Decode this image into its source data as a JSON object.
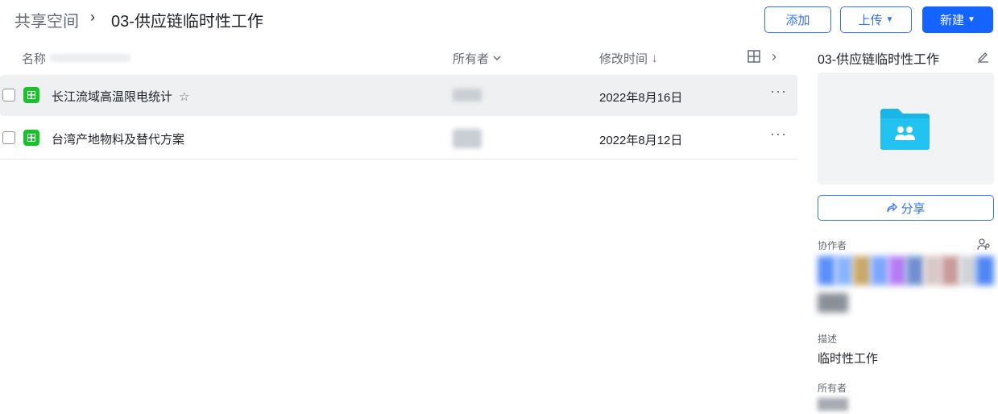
{
  "breadcrumb": {
    "root": "共享空间",
    "separator": "›",
    "current": "03-供应链临时性工作"
  },
  "toolbar": {
    "add_label": "添加",
    "upload_label": "上传",
    "new_label": "新建"
  },
  "table": {
    "columns": {
      "name": "名称",
      "owner": "所有者",
      "modified": "修改时间"
    },
    "sort_arrow": "↓",
    "rows": [
      {
        "name": "长江流域高温限电统计",
        "modified": "2022年8月16日",
        "icon": "sheet-icon",
        "starred_icon": "star-outline-icon"
      },
      {
        "name": "台湾产地物料及替代方案",
        "modified": "2022年8月12日",
        "icon": "sheet-icon"
      }
    ],
    "more_glyph": "···"
  },
  "detail_panel": {
    "title": "03-供应链临时性工作",
    "share_label": "分享",
    "collaborators_label": "协作者",
    "description_label": "描述",
    "description_value": "临时性工作",
    "owner_label": "所有者"
  },
  "colors": {
    "accent": "#3370ff",
    "primary_button": "#1664ff",
    "sheet_icon": "#16c42a",
    "folder": "#19b5e6"
  }
}
